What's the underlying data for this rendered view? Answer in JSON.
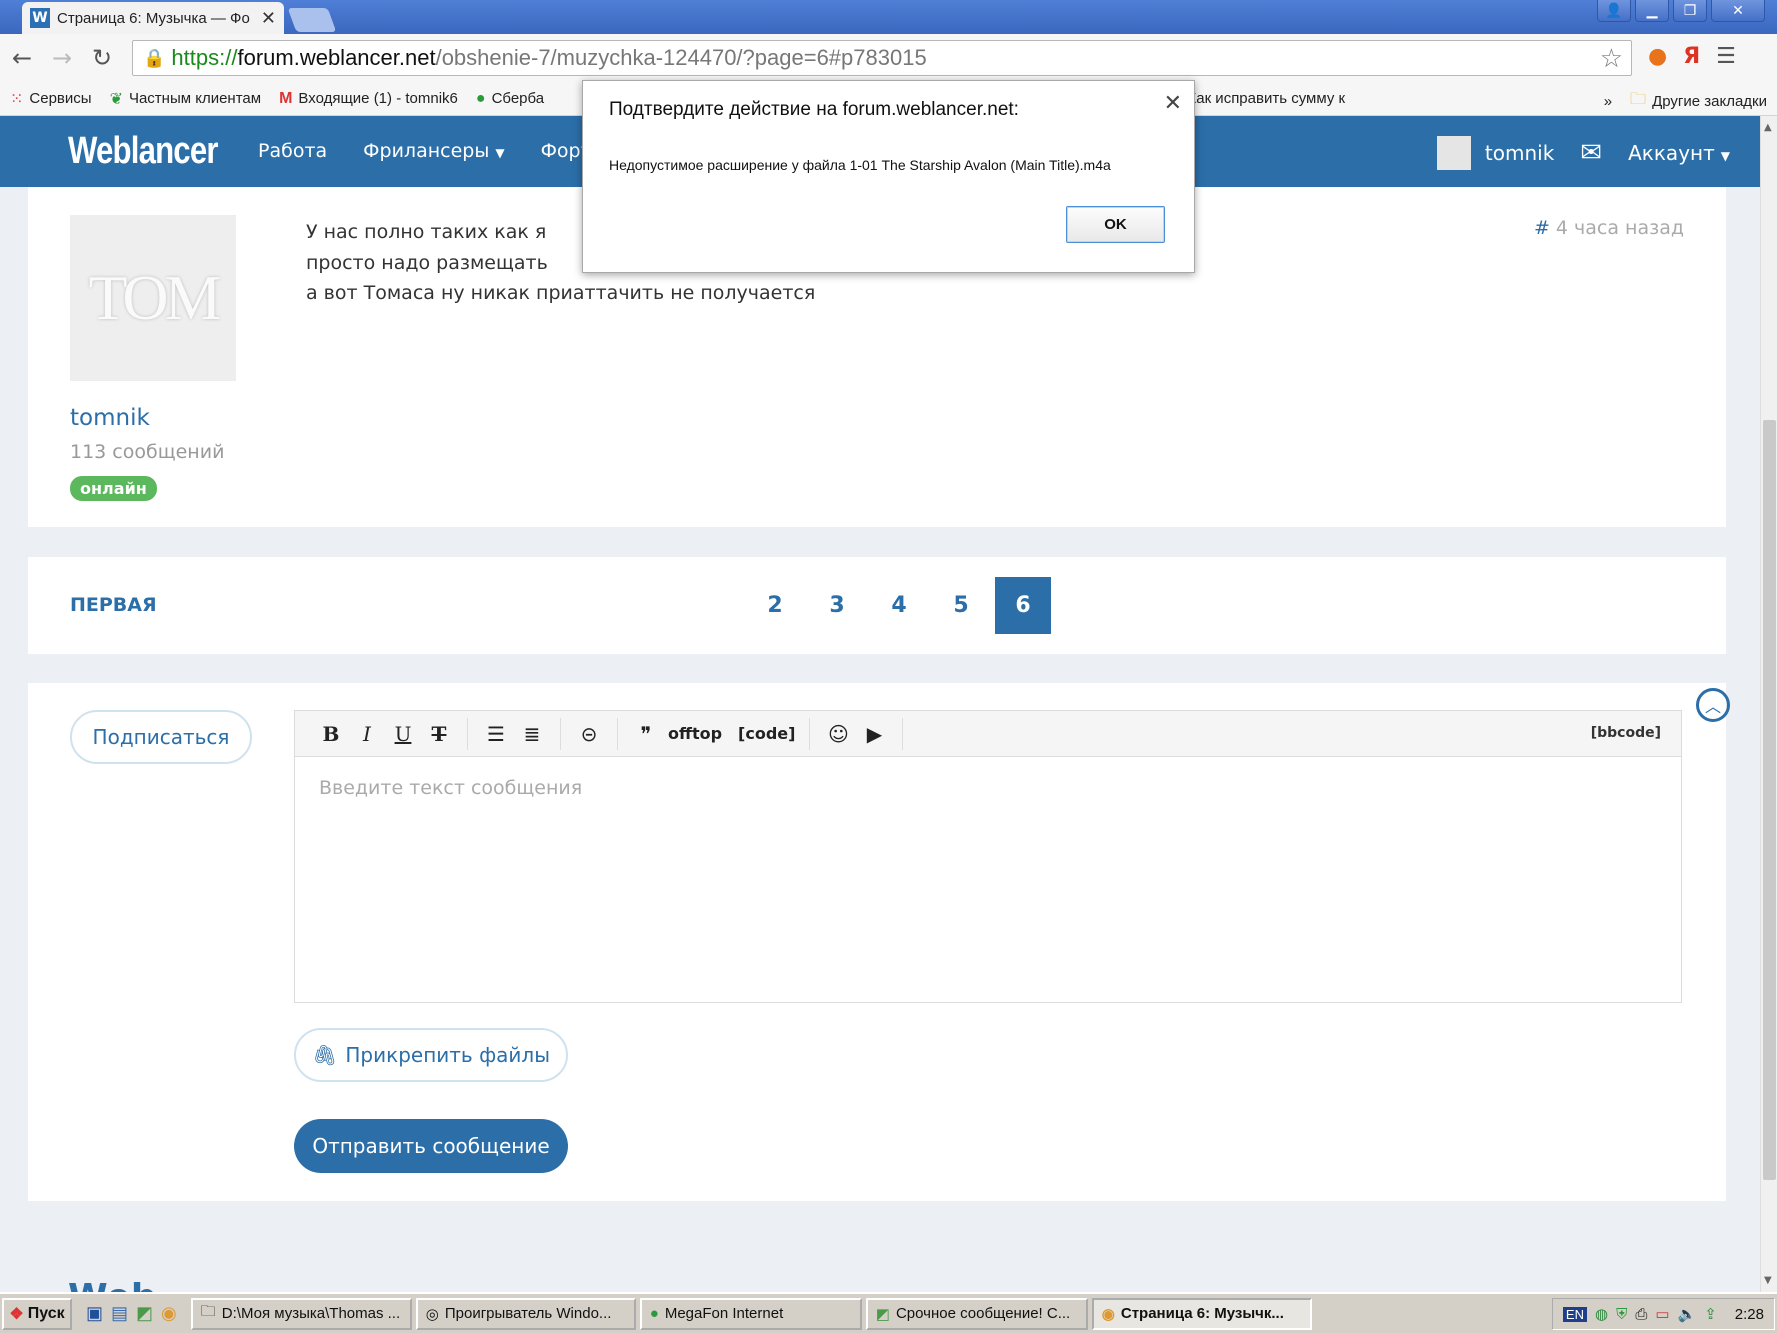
{
  "browser": {
    "tab_title": "Страница 6: Музычка — Фо",
    "tab_favicon": "W",
    "url_protocol": "https://",
    "url_host": "forum.weblancer.net",
    "url_path": "/obshenie-7/muzychka-124470/?page=6#p783015",
    "bookmarks": [
      {
        "icon": "apps-icon",
        "label": "Сервисы"
      },
      {
        "icon": "leaf-icon",
        "label": "Частным клиентам"
      },
      {
        "icon": "gmail-icon",
        "label": "Входящие (1) - tomnik6"
      },
      {
        "icon": "sber-icon",
        "label": "Сберба"
      },
      {
        "icon": "sun-icon",
        "label": "Как исправить сумму к"
      }
    ],
    "bookmarks_more": "»",
    "other_bookmarks": "Другие закладки",
    "ext_yandex": "Я"
  },
  "site": {
    "logo": "Weblancer",
    "nav": [
      {
        "label": "Работа",
        "dropdown": false
      },
      {
        "label": "Фрилансеры",
        "dropdown": true
      },
      {
        "label": "Фору",
        "dropdown": false
      }
    ],
    "user": "tomnik",
    "account": "Аккаунт"
  },
  "post": {
    "avatar_text": "TOM",
    "author": "tomnik",
    "message_count": "113 сообщений",
    "status": "онлайн",
    "lines": [
      "У нас полно таких как я",
      "просто надо размещать",
      "а вот Томаса ну никак приаттачить не получается"
    ],
    "time_hash": "#",
    "time": "4 часа назад"
  },
  "pager": {
    "first": "ПЕРВАЯ",
    "pages": [
      "2",
      "3",
      "4",
      "5",
      "6"
    ],
    "current": "6"
  },
  "reply": {
    "subscribe": "Подписаться",
    "toolbar": {
      "bold": "B",
      "italic": "I",
      "underline": "U",
      "strike": "T",
      "quote": "❞",
      "offtop": "offtop",
      "code": "[code]",
      "bbcode": "[bbcode]"
    },
    "placeholder": "Введите текст сообщения",
    "attach": "Прикрепить файлы",
    "send": "Отправить сообщение"
  },
  "footer_peek": "Web",
  "dialog": {
    "title": "Подтвердите действие на forum.weblancer.net:",
    "message": "Недопустимое расширение у файла 1-01 The Starship Avalon (Main Title).m4a",
    "ok": "OK"
  },
  "taskbar": {
    "start": "Пуск",
    "tasks": [
      {
        "label": "D:\\Моя музыка\\Thomas ...",
        "active": false
      },
      {
        "label": "Проигрыватель Windo...",
        "active": false
      },
      {
        "label": "MegaFon Internet",
        "active": false
      },
      {
        "label": "Срочное сообщение! С...",
        "active": false
      },
      {
        "label": "Страница 6: Музычк...",
        "active": true
      }
    ],
    "lang": "EN",
    "clock": "2:28"
  },
  "colors": {
    "brand": "#2b6ea8",
    "online": "#5cb85c"
  }
}
